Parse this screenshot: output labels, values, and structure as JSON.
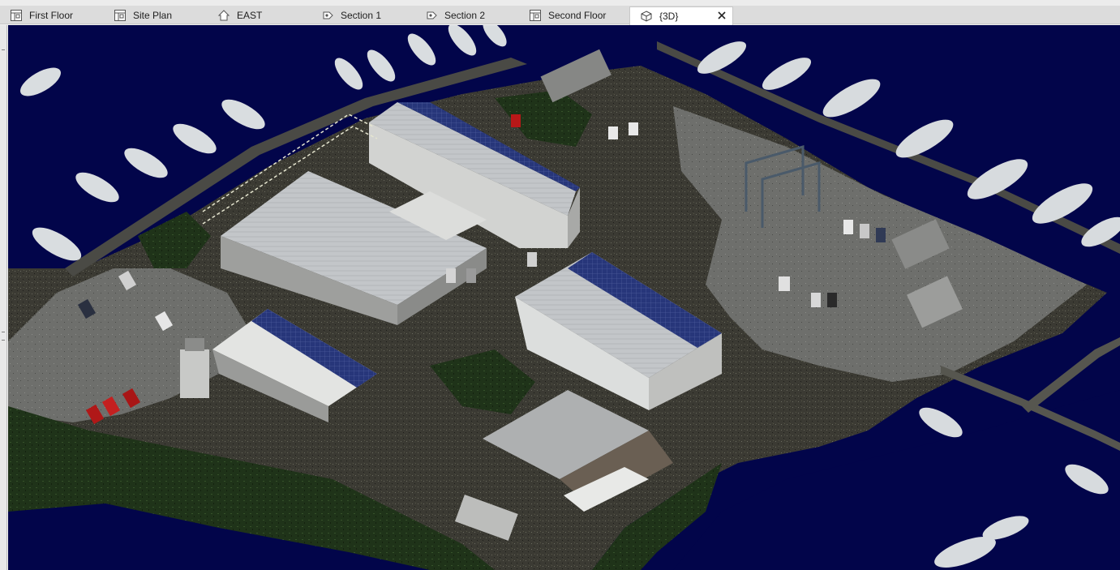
{
  "tabs": [
    {
      "label": "First Floor",
      "icon": "floor-plan-icon",
      "active": false
    },
    {
      "label": "Site Plan",
      "icon": "floor-plan-icon",
      "active": false
    },
    {
      "label": "EAST",
      "icon": "elevation-icon",
      "active": false
    },
    {
      "label": "Section 1",
      "icon": "section-icon",
      "active": false
    },
    {
      "label": "Section 2",
      "icon": "section-icon",
      "active": false
    },
    {
      "label": "Second Floor",
      "icon": "floor-plan-icon",
      "active": false
    },
    {
      "label": "{3D}",
      "icon": "3d-view-icon",
      "active": true
    }
  ],
  "colors": {
    "water": "#02054a",
    "land": "#3a3a32",
    "vegetation": "#24381c",
    "roof_metal": "#c9ccce",
    "solar_panel": "#2a3a7a",
    "tab_bar": "#dcdcdc",
    "active_tab": "#ffffff"
  },
  "viewport": {
    "content": "3d-point-cloud-marina"
  }
}
